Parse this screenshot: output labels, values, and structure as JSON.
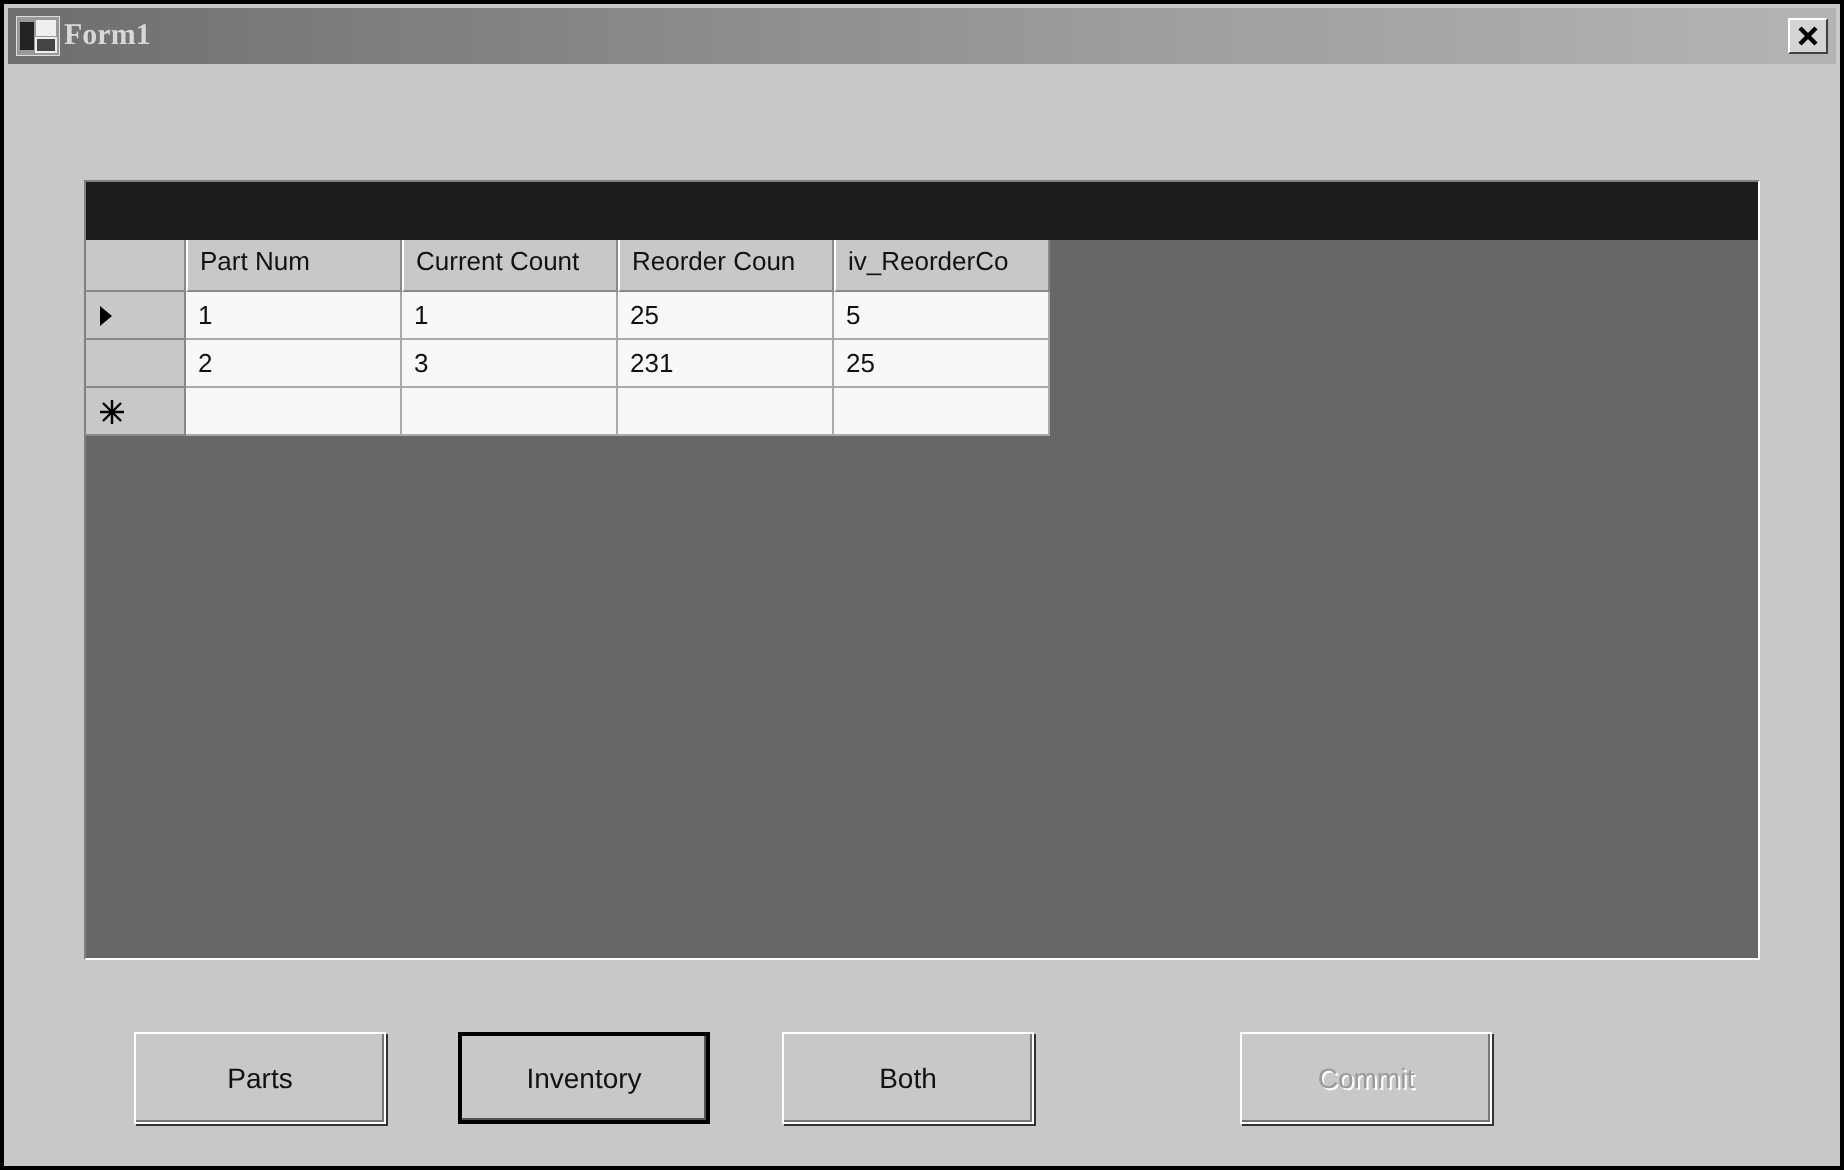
{
  "window": {
    "title": "Form1"
  },
  "grid": {
    "columns": [
      "Part Num",
      "Current Count",
      "Reorder Coun",
      "iv_ReorderCo"
    ],
    "rows": [
      {
        "kind": "data",
        "current": true,
        "cells": [
          "1",
          "1",
          "25",
          "5"
        ]
      },
      {
        "kind": "data",
        "current": false,
        "cells": [
          "2",
          "3",
          "231",
          "25"
        ]
      },
      {
        "kind": "new"
      }
    ]
  },
  "buttons": [
    {
      "label": "Parts",
      "default": false,
      "disabled": false
    },
    {
      "label": "Inventory",
      "default": true,
      "disabled": false
    },
    {
      "label": "Both",
      "default": false,
      "disabled": false
    },
    {
      "label": "Commit",
      "default": false,
      "disabled": true
    }
  ]
}
